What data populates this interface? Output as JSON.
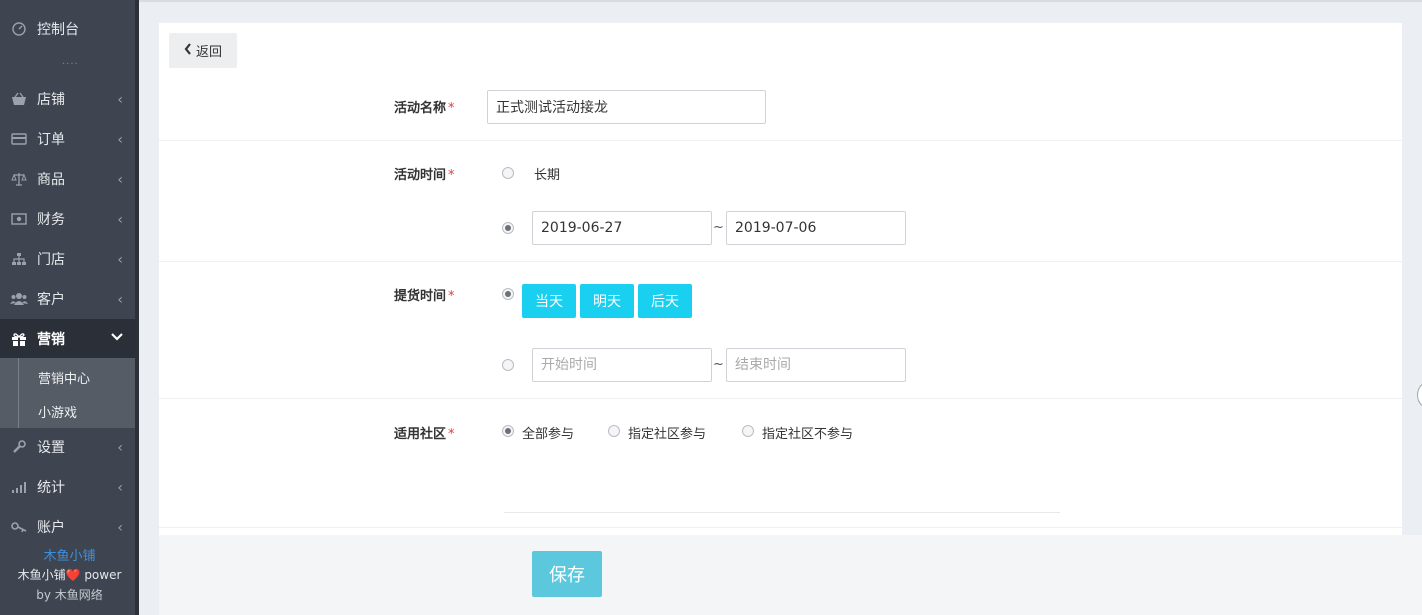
{
  "sidebar": {
    "items": [
      {
        "key": "dashboard",
        "label": "控制台",
        "icon": "dashboard-icon",
        "chevron": false
      },
      {
        "key": "shop",
        "label": "店铺",
        "icon": "basket-icon",
        "chevron": true
      },
      {
        "key": "orders",
        "label": "订单",
        "icon": "card-icon",
        "chevron": true
      },
      {
        "key": "goods",
        "label": "商品",
        "icon": "balance-scale-icon",
        "chevron": true
      },
      {
        "key": "finance",
        "label": "财务",
        "icon": "money-icon",
        "chevron": true
      },
      {
        "key": "stores",
        "label": "门店",
        "icon": "sitemap-icon",
        "chevron": true
      },
      {
        "key": "customers",
        "label": "客户",
        "icon": "users-icon",
        "chevron": true
      },
      {
        "key": "marketing",
        "label": "营销",
        "icon": "gift-icon",
        "chevron": true,
        "active": true
      },
      {
        "key": "settings",
        "label": "设置",
        "icon": "wrench-icon",
        "chevron": true
      },
      {
        "key": "stats",
        "label": "统计",
        "icon": "signal-bars-icon",
        "chevron": true
      },
      {
        "key": "account",
        "label": "账户",
        "icon": "key-icon",
        "chevron": true
      }
    ],
    "sub_items": [
      "营销中心",
      "小游戏"
    ],
    "divider": "....",
    "brand": {
      "name": "木鱼小铺",
      "power_line": "木鱼小铺❤️ power",
      "by_line": "by 木鱼网络"
    },
    "colors": {
      "brand_name": "#3d8fe0",
      "bg": "#3f4550",
      "active_bg": "#2b3038"
    }
  },
  "header": {
    "back_label": "返回"
  },
  "form": {
    "name": {
      "label": "活动名称",
      "required": "*",
      "value": "正式测试活动接龙"
    },
    "time": {
      "label": "活动时间",
      "required": "*",
      "option_long": "长期",
      "start": "2019-06-27",
      "end": "2019-07-06",
      "separator": "~"
    },
    "pickup": {
      "label": "提货时间",
      "required": "*",
      "chips": [
        "当天",
        "明天",
        "后天"
      ],
      "start_placeholder": "开始时间",
      "end_placeholder": "结束时间",
      "separator": "~"
    },
    "community": {
      "label": "适用社区",
      "required": "*",
      "options": [
        "全部参与",
        "指定社区参与",
        "指定社区不参与"
      ]
    }
  },
  "footer": {
    "save_label": "保存"
  },
  "colors": {
    "accent": "#1ad0f0",
    "save": "#5bc8de",
    "required": "#e4393c"
  }
}
